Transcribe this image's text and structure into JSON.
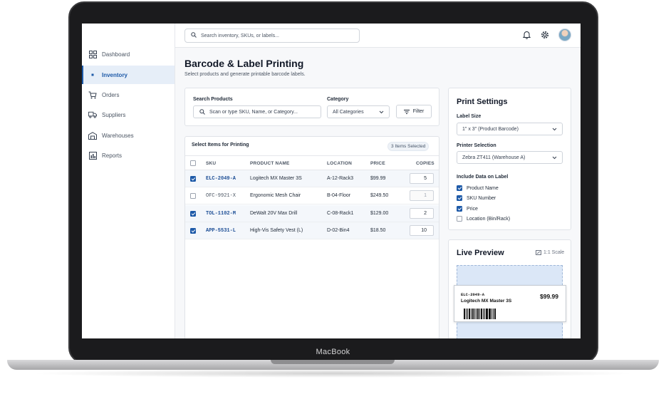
{
  "device": {
    "brand_label": "MacBook"
  },
  "sidebar": {
    "items": [
      {
        "label": "Dashboard",
        "icon": "dashboard-icon",
        "active": false
      },
      {
        "label": "Inventory",
        "icon": "inventory-icon",
        "active": true
      },
      {
        "label": "Orders",
        "icon": "cart-icon",
        "active": false
      },
      {
        "label": "Suppliers",
        "icon": "truck-icon",
        "active": false
      },
      {
        "label": "Warehouses",
        "icon": "warehouse-icon",
        "active": false
      },
      {
        "label": "Reports",
        "icon": "reports-icon",
        "active": false
      }
    ]
  },
  "topbar": {
    "search_placeholder": "Search inventory, SKUs, or labels...",
    "icons": [
      "bell-icon",
      "gear-icon",
      "avatar"
    ]
  },
  "page": {
    "title": "Barcode & Label Printing",
    "subtitle": "Select products and generate printable barcode labels."
  },
  "filters": {
    "search_label": "Search Products",
    "search_placeholder": "Scan or type SKU, Name, or Category...",
    "category_label": "Category",
    "category_value": "All Categories",
    "filter_button": "Filter"
  },
  "table": {
    "title": "Select Items for Printing",
    "selected_badge": "3 Items Selected",
    "columns": [
      "SKU",
      "PRODUCT NAME",
      "LOCATION",
      "PRICE",
      "COPIES"
    ],
    "rows": [
      {
        "selected": true,
        "sku": "ELC-2049-A",
        "name": "Logitech MX Master 3S",
        "location": "A-12-Rack3",
        "price": "$99.99",
        "copies": "5"
      },
      {
        "selected": false,
        "sku": "OFC-9921-X",
        "name": "Ergonomic Mesh Chair",
        "location": "B-04-Floor",
        "price": "$249.50",
        "copies": "1"
      },
      {
        "selected": true,
        "sku": "TOL-1102-M",
        "name": "DeWalt 20V Max Drill",
        "location": "C-08-Rack1",
        "price": "$129.00",
        "copies": "2"
      },
      {
        "selected": true,
        "sku": "APP-5531-L",
        "name": "High-Vis Safety Vest (L)",
        "location": "D-02-Bin4",
        "price": "$18.50",
        "copies": "10"
      }
    ]
  },
  "print_settings": {
    "title": "Print Settings",
    "label_size_label": "Label Size",
    "label_size_value": "1\" x 3\" (Product Barcode)",
    "printer_label": "Printer Selection",
    "printer_value": "Zebra ZT411 (Warehouse A)",
    "include_label": "Include Data on Label",
    "options": [
      {
        "label": "Product Name",
        "checked": true
      },
      {
        "label": "SKU Number",
        "checked": true
      },
      {
        "label": "Price",
        "checked": true
      },
      {
        "label": "Location (Bin/Rack)",
        "checked": false
      }
    ]
  },
  "live_preview": {
    "title": "Live Preview",
    "scale": "1:1 Scale",
    "label_sku": "ELC-2049-A",
    "label_name": "Logitech MX Master 3S",
    "label_price": "$99.99"
  },
  "colors": {
    "accent": "#1e5aa8",
    "sku_text": "#1e4f96"
  }
}
